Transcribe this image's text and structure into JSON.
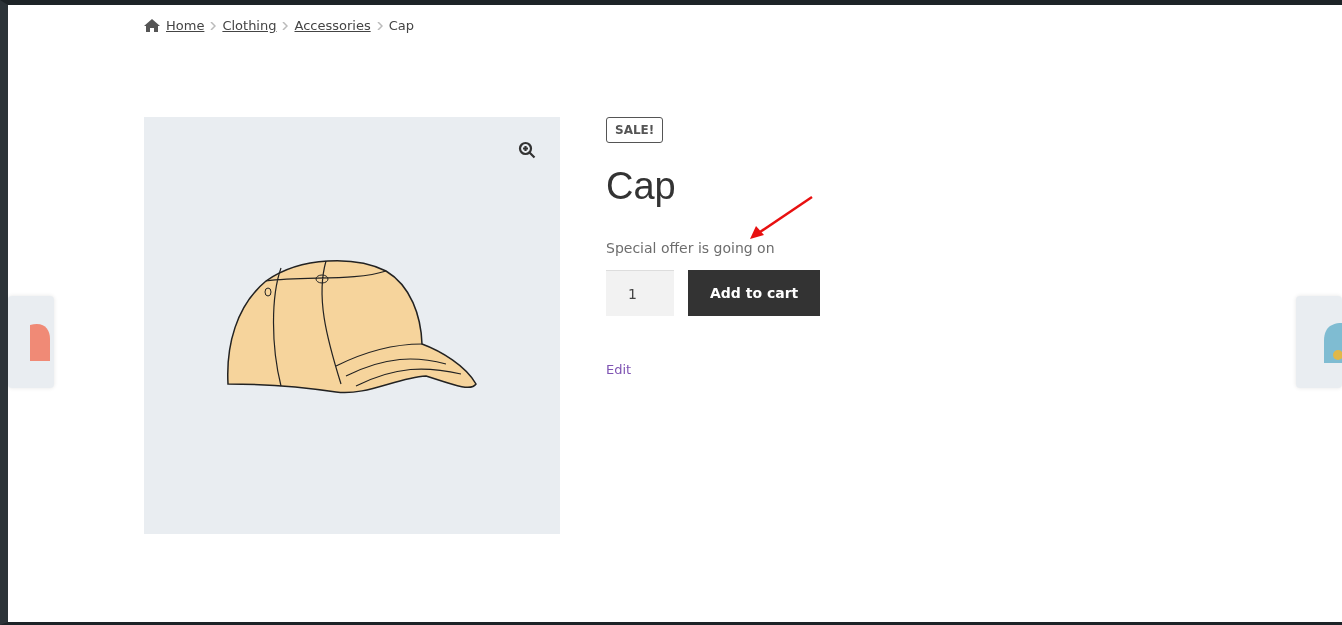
{
  "breadcrumb": [
    {
      "label": "Home",
      "current": false
    },
    {
      "label": "Clothing",
      "current": false
    },
    {
      "label": "Accessories",
      "current": false
    },
    {
      "label": "Cap",
      "current": true
    }
  ],
  "product": {
    "badge": "SALE!",
    "title": "Cap",
    "description": "Special offer is going on",
    "quantity": "1",
    "add_button": "Add to cart",
    "edit_link": "Edit"
  }
}
